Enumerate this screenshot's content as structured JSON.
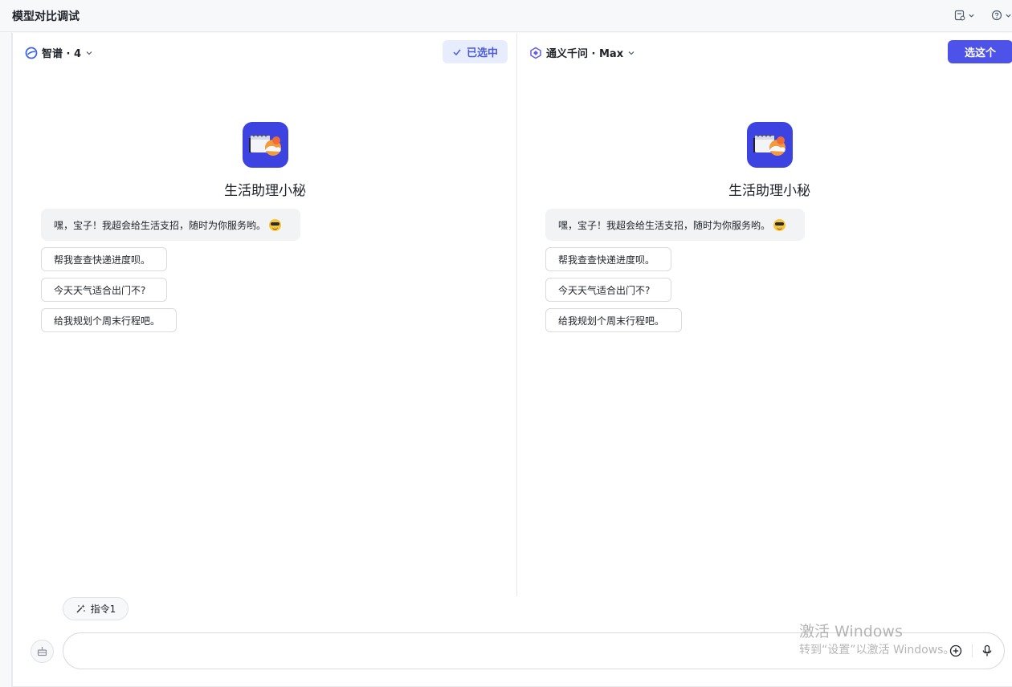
{
  "header": {
    "title": "模型对比调试",
    "icons": [
      "doc-settings-icon",
      "help-icon"
    ]
  },
  "left_pane": {
    "model_name": "智谱 · 4",
    "selected_label": "已选中",
    "bot_name": "生活助理小秘",
    "greeting": "嘿，宝子！我超会给生活支招，随时为你服务哟。",
    "suggestions": [
      "帮我查查快递进度呗。",
      "今天天气适合出门不?",
      "给我规划个周末行程吧。"
    ]
  },
  "right_pane": {
    "model_name": "通义千问 · Max",
    "choose_label": "选这个",
    "bot_name": "生活助理小秘",
    "greeting": "嘿，宝子！我超会给生活支招，随时为你服务哟。",
    "suggestions": [
      "帮我查查快递进度呗。",
      "今天天气适合出门不?",
      "给我规划个周末行程吧。"
    ]
  },
  "composer": {
    "command_chip": "指令1",
    "input_value": "",
    "input_placeholder": ""
  },
  "watermark": {
    "line1": "激活 Windows",
    "line2": "转到“设置”以激活 Windows。"
  },
  "colors": {
    "accent": "#4d53e8",
    "selected_bg": "#e8edfd",
    "avatar_bg": "#3c43e0"
  }
}
